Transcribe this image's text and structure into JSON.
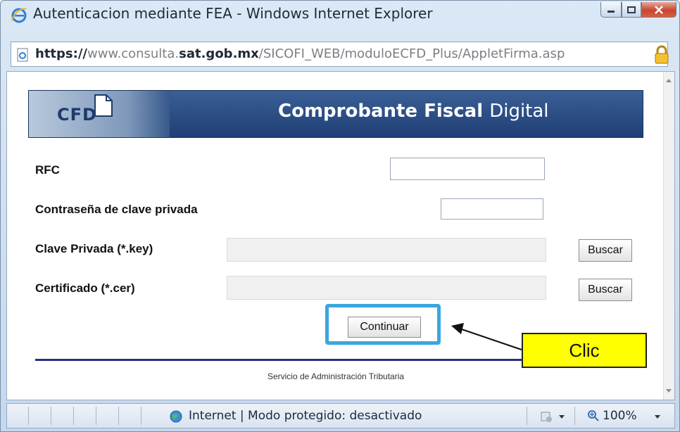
{
  "window": {
    "title": "Autenticacion mediante FEA - Windows Internet Explorer"
  },
  "address": {
    "scheme": "https://",
    "sub": "www.consulta.",
    "domain": "sat.gob.mx",
    "path": "/SICOFI_WEB/moduloECFD_Plus/AppletFirma.asp"
  },
  "banner": {
    "logo": "CFD",
    "title_bold": "Comprobante Fiscal",
    "title_thin": "Digital"
  },
  "form": {
    "rfc_label": "RFC",
    "rfc_value": "",
    "password_label": "Contraseña de clave privada",
    "password_value": "",
    "key_label": "Clave Privada (*.key)",
    "cert_label": "Certificado (*.cer)",
    "browse_label": "Buscar",
    "continue_label": "Continuar"
  },
  "footer": {
    "text": "Servicio de Administración Tributaria"
  },
  "annotation": {
    "callout": "Clic",
    "highlight_color": "#3aa6e0",
    "callout_color": "#ffff00"
  },
  "status": {
    "zone": "Internet | Modo protegido: desactivado",
    "zoom": "100%"
  },
  "icons": {
    "title": "ie-logo-icon",
    "page": "page-icon",
    "lock": "lock-icon",
    "globe": "globe-icon"
  }
}
